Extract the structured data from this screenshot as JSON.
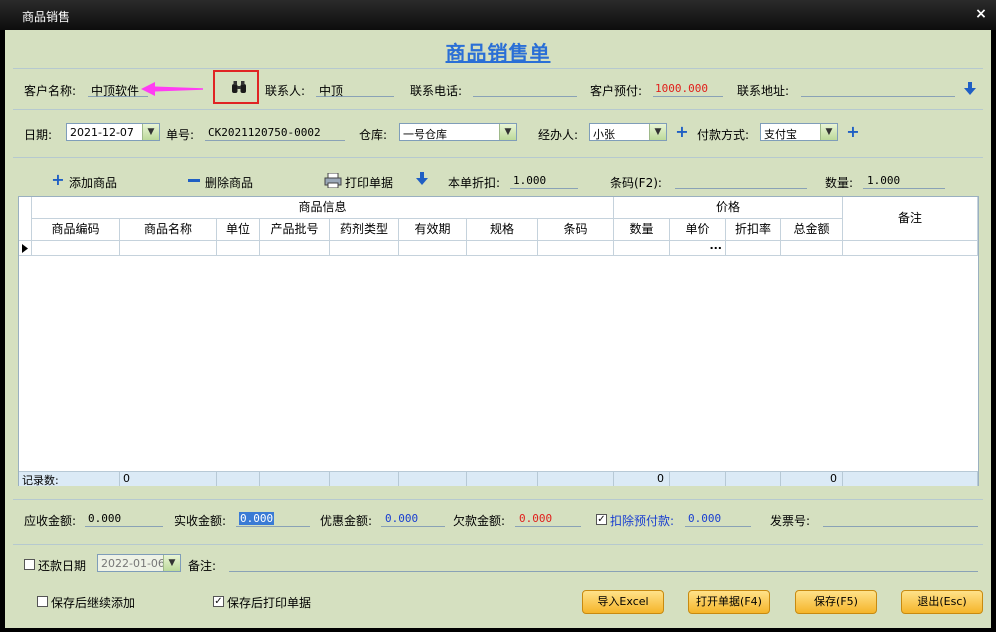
{
  "window": {
    "title": "商品销售",
    "close_glyph": "×"
  },
  "form_title": "商品销售单",
  "row1": {
    "customer_label": "客户名称:",
    "customer_value": "中顶软件",
    "contact_label": "联系人:",
    "contact_value": "中顶",
    "phone_label": "联系电话:",
    "phone_value": "",
    "prepay_label": "客户预付:",
    "prepay_value": "1000.000",
    "address_label": "联系地址:",
    "address_value": ""
  },
  "row2": {
    "date_label": "日期:",
    "date_value": "2021-12-07",
    "order_label": "单号:",
    "order_value": "CK2021120750-0002",
    "warehouse_label": "仓库:",
    "warehouse_value": "一号仓库",
    "handler_label": "经办人:",
    "handler_value": "小张",
    "payment_label": "付款方式:",
    "payment_value": "支付宝"
  },
  "toolbar": {
    "add_label": "添加商品",
    "delete_label": "删除商品",
    "print_label": "打印单据",
    "discount_label": "本单折扣:",
    "discount_value": "1.000",
    "barcode_label": "条码(F2):",
    "barcode_value": "",
    "qty_label": "数量:",
    "qty_value": "1.000"
  },
  "grid": {
    "group_info": "商品信息",
    "group_price": "价格",
    "remark": "备注",
    "columns": [
      "商品编码",
      "商品名称",
      "单位",
      "产品批号",
      "药剂类型",
      "有效期",
      "规格",
      "条码",
      "数量",
      "单价",
      "折扣率",
      "总金额"
    ],
    "ellipsis": "...",
    "footer": {
      "records_label": "记录数:",
      "records_value": "0",
      "qty_total": "0",
      "amount_total": "0"
    }
  },
  "totals": {
    "receivable_label": "应收金额:",
    "receivable_value": "0.000",
    "received_label": "实收金额:",
    "received_value": "0.000",
    "discount_label": "优惠金额:",
    "discount_value": "0.000",
    "owed_label": "欠款金额:",
    "owed_value": "0.000",
    "deduct_label": "扣除预付款:",
    "deduct_value": "0.000",
    "deduct_checked": true,
    "invoice_label": "发票号:",
    "invoice_value": ""
  },
  "bottom": {
    "repay_label": "还款日期",
    "repay_date": "2022-01-06",
    "remark_label": "备注:",
    "keep_adding_label": "保存后继续添加",
    "print_after_save_label": "保存后打印单据",
    "import_button": "导入Excel",
    "open_button": "打开单据(F4)",
    "save_button": "保存(F5)",
    "exit_button": "退出(Esc)"
  },
  "colors": {
    "panel": "#d5e0c0",
    "title_blue": "#2a6fd6",
    "red_value": "#e0201c",
    "blue_value": "#1a3fd0",
    "button": "#f5b52a",
    "arrow": "#ff3df2"
  }
}
